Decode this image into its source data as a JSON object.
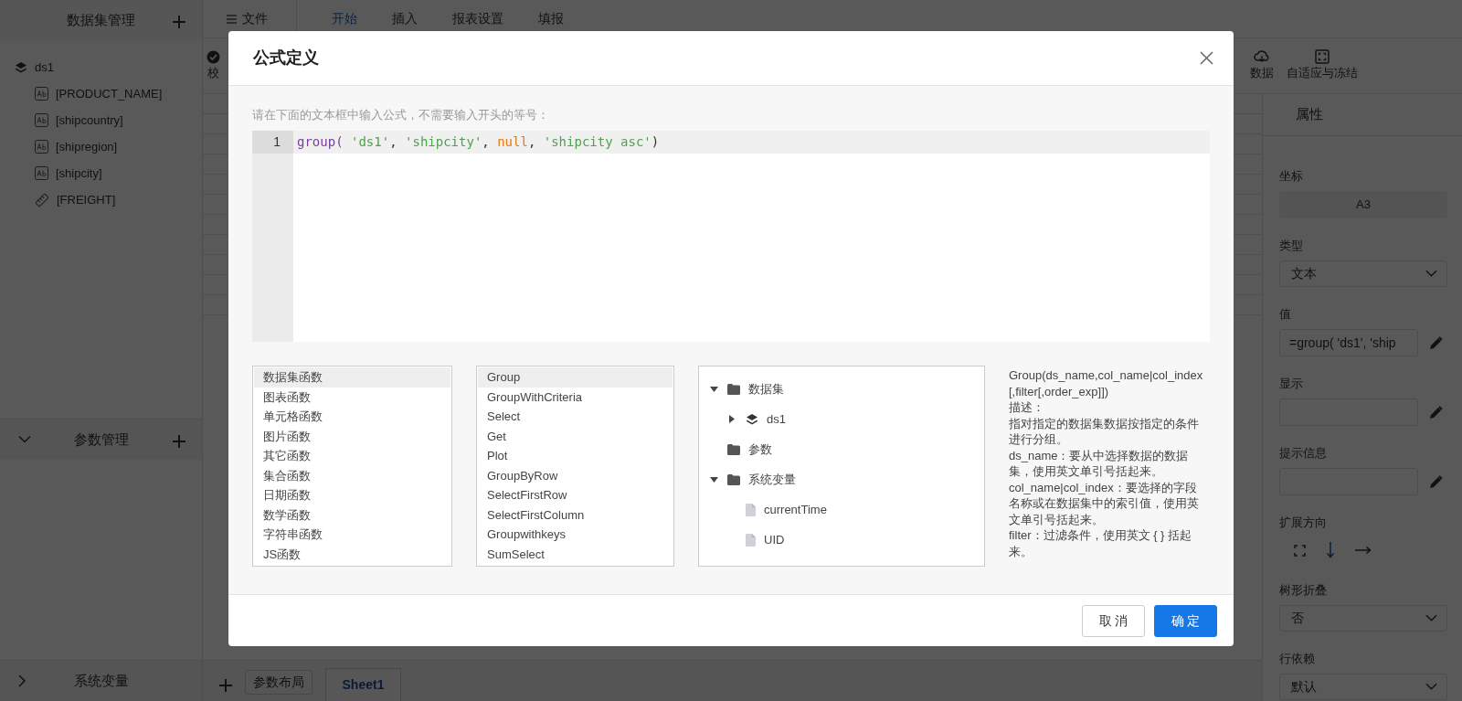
{
  "left_panel": {
    "title": "数据集管理",
    "dataset": {
      "label": "ds1",
      "fields": [
        {
          "label": "[PRODUCT_NAME]",
          "kind": "text"
        },
        {
          "label": "[shipcountry]",
          "kind": "text"
        },
        {
          "label": "[shipregion]",
          "kind": "text"
        },
        {
          "label": "[shipcity]",
          "kind": "text"
        },
        {
          "label": "[FREIGHT]",
          "kind": "number"
        }
      ]
    },
    "sections": [
      {
        "title": "参数管理",
        "expanded": true
      },
      {
        "title": "系统变量",
        "expanded": false
      }
    ]
  },
  "menu": {
    "file": "文件",
    "tabs": [
      {
        "label": "开始",
        "selected": true
      },
      {
        "label": "插入",
        "selected": false
      },
      {
        "label": "报表设置",
        "selected": false
      },
      {
        "label": "填报",
        "selected": false
      }
    ]
  },
  "toolbar": {
    "left": [
      {
        "label": "校",
        "kind": "check"
      }
    ],
    "right": [
      {
        "label": "数据",
        "kind": "cloud"
      },
      {
        "label": "自适应与冻结",
        "kind": "frame"
      }
    ]
  },
  "sheet": {
    "layout_button": "参数布局",
    "tabs": [
      {
        "label": "Sheet1",
        "selected": true
      }
    ]
  },
  "properties": {
    "title": "属性",
    "fields": [
      {
        "kind": "readonly",
        "label": "坐标",
        "value": "A3"
      },
      {
        "kind": "select",
        "label": "类型",
        "value": "文本"
      },
      {
        "kind": "input",
        "label": "值",
        "value": "=group( 'ds1', 'ship"
      },
      {
        "kind": "input",
        "label": "显示"
      },
      {
        "kind": "input",
        "label": "提示信息"
      },
      {
        "kind": "direction",
        "label": "扩展方向",
        "options": [
          {
            "kind": "expand",
            "selected": false
          },
          {
            "kind": "down",
            "selected": true
          },
          {
            "kind": "right",
            "selected": false
          }
        ]
      },
      {
        "kind": "select",
        "label": "树形折叠",
        "value": "否"
      },
      {
        "kind": "select",
        "label": "行依赖",
        "value": "默认"
      }
    ]
  },
  "dialog": {
    "title": "公式定义",
    "hint": "请在下面的文本框中输入公式，不需要输入开头的等号：",
    "editor": {
      "line_number": "1",
      "tokens": [
        {
          "kind": "function",
          "text": "group( "
        },
        {
          "kind": "string",
          "text": "'ds1'"
        },
        {
          "kind": "plain",
          "text": ", "
        },
        {
          "kind": "string",
          "text": "'shipcity'"
        },
        {
          "kind": "plain",
          "text": ", "
        },
        {
          "kind": "keyword",
          "text": "null"
        },
        {
          "kind": "plain",
          "text": ", "
        },
        {
          "kind": "string",
          "text": "'shipcity asc'"
        },
        {
          "kind": "plain",
          "text": ")"
        }
      ]
    },
    "categories": [
      {
        "label": "数据集函数",
        "selected": true
      },
      {
        "label": "图表函数",
        "selected": false
      },
      {
        "label": "单元格函数",
        "selected": false
      },
      {
        "label": "图片函数",
        "selected": false
      },
      {
        "label": "其它函数",
        "selected": false
      },
      {
        "label": "集合函数",
        "selected": false
      },
      {
        "label": "日期函数",
        "selected": false
      },
      {
        "label": "数学函数",
        "selected": false
      },
      {
        "label": "字符串函数",
        "selected": false
      },
      {
        "label": "JS函数",
        "selected": false
      }
    ],
    "functions": [
      {
        "label": "Group",
        "selected": true
      },
      {
        "label": "GroupWithCriteria",
        "selected": false
      },
      {
        "label": "Select",
        "selected": false
      },
      {
        "label": "Get",
        "selected": false
      },
      {
        "label": "Plot",
        "selected": false
      },
      {
        "label": "GroupByRow",
        "selected": false
      },
      {
        "label": "SelectFirstRow",
        "selected": false
      },
      {
        "label": "SelectFirstColumn",
        "selected": false
      },
      {
        "label": "Groupwithkeys",
        "selected": false
      },
      {
        "label": "SumSelect",
        "selected": false
      }
    ],
    "tree": [
      {
        "label": "数据集",
        "kind": "folder",
        "expanded": true,
        "children": [
          {
            "label": "ds1",
            "kind": "dataset",
            "expanded": false
          }
        ]
      },
      {
        "label": "参数",
        "kind": "folder"
      },
      {
        "label": "系统变量",
        "kind": "folder",
        "expanded": true,
        "children": [
          {
            "label": "currentTime",
            "kind": "file"
          },
          {
            "label": "UID",
            "kind": "file"
          }
        ]
      }
    ],
    "description": [
      "Group(ds_name,col_name|col_index[,filter[,order_exp]])",
      "描述：",
      "指对指定的数据集数据按指定的条件进行分组。",
      "ds_name：要从中选择数据的数据集，使用英文单引号括起来。",
      "col_name|col_index：要选择的字段名称或在数据集中的索引值，使用英文单引号括起来。",
      "filter：过滤条件，使用英文 { } 括起来。"
    ],
    "buttons": [
      {
        "label": "取 消",
        "kind": "secondary"
      },
      {
        "label": "确 定",
        "kind": "primary"
      }
    ]
  }
}
